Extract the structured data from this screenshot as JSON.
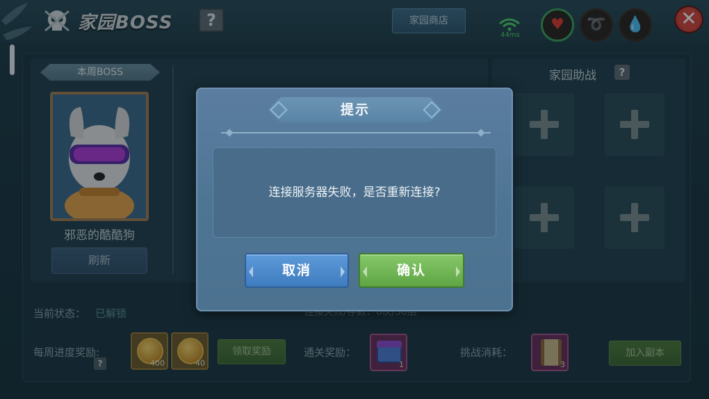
{
  "topbar": {
    "title": "家园BOSS",
    "help_label": "?",
    "shop_label": "家园商店",
    "ping": "44ms",
    "close_label": "✕"
  },
  "boss": {
    "weekly_banner": "本周BOSS",
    "name": "邪恶的酷酷狗",
    "refresh_label": "刷新"
  },
  "assist": {
    "title": "家园助战",
    "help_label": "?"
  },
  "status": {
    "label": "当前状态：",
    "value": "已解锁",
    "progress_text": "连接失败/存数：0次/50层"
  },
  "rewards": {
    "weekly_label": "每周进度奖励:",
    "help_label": "?",
    "coin_items": [
      {
        "qty": "400"
      },
      {
        "qty": "40"
      }
    ],
    "claim_label": "领取奖励",
    "clear_label": "通关奖励：",
    "chest_qty": "1",
    "cost_label": "挑战消耗：",
    "scroll_qty": "3",
    "join_label": "加入副本"
  },
  "dialog": {
    "title": "提示",
    "message": "连接服务器失败，是否重新连接?",
    "cancel_label": "取消",
    "confirm_label": "确认"
  },
  "colors": {
    "confirm": "#5fa544",
    "cancel": "#3f7cc0",
    "close": "#d8443b"
  }
}
